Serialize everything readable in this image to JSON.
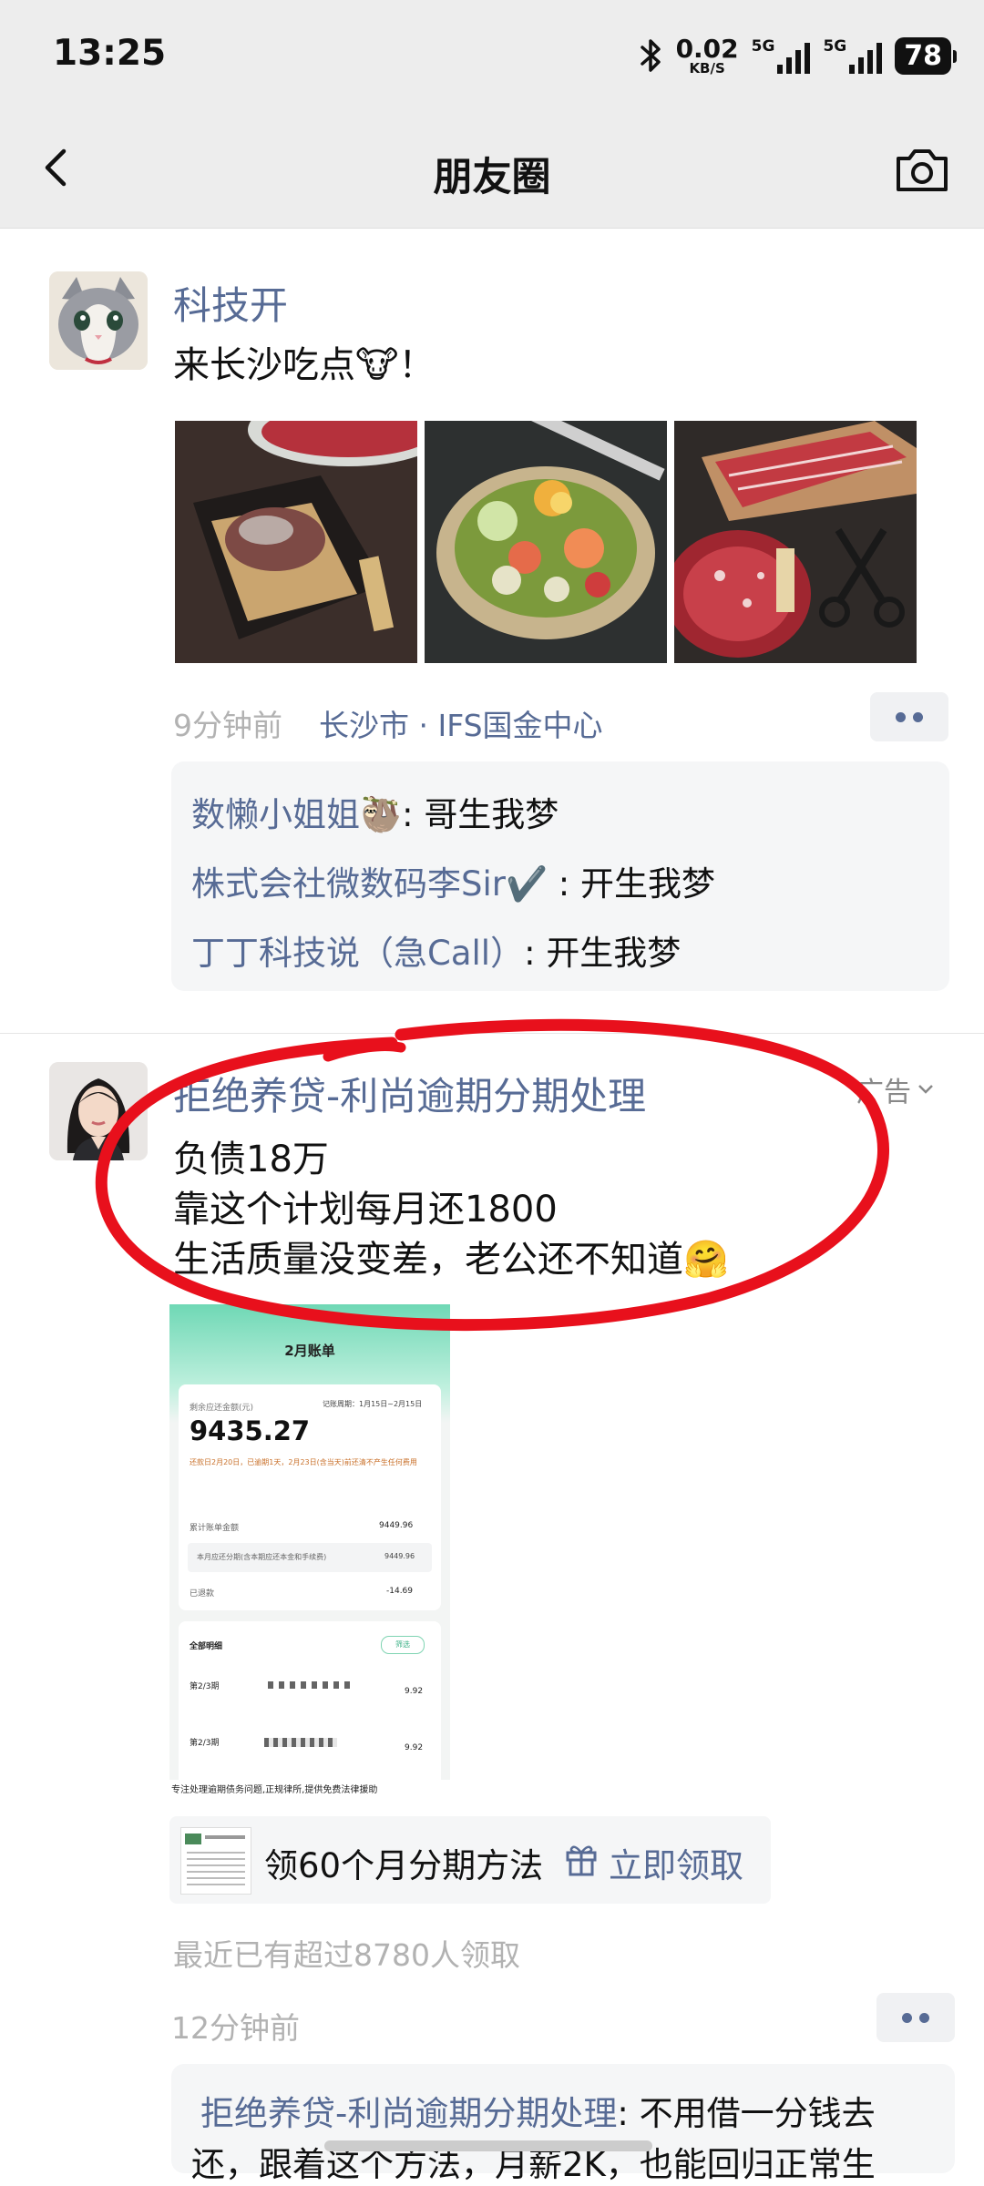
{
  "status_bar": {
    "time": "13:25",
    "net_speed": "0.02",
    "net_unit": "KB/S",
    "signal_1": "5G",
    "signal_2": "5G",
    "battery": "78"
  },
  "nav": {
    "title": "朋友圈"
  },
  "post1": {
    "author": "科技开",
    "text": "来长沙吃点🐮！",
    "time": "9分钟前",
    "location": "长沙市 · IFS国金中心",
    "comments": [
      {
        "name": "数懒小姐姐🦥",
        "sep": ": ",
        "text": "哥生我梦"
      },
      {
        "name": "株式会社微数码李Sir✔️",
        "sep": " : ",
        "text": "开生我梦"
      },
      {
        "name": "丁丁科技说（急Call）",
        "sep": ": ",
        "text": "开生我梦"
      }
    ]
  },
  "post2": {
    "author": "拒绝养贷-利尚逾期分期处理",
    "ad_label": "广告",
    "lines": [
      "负债18万",
      "靠这个计划每月还1800",
      "生活质量没变差，老公还不知道🤗"
    ],
    "bill": {
      "title": "2月账单",
      "remaining_label": "剩余应还金额(元)",
      "cycle": "记账周期：1月15日~2月15日",
      "amount": "9435.27",
      "notice": "还款日2月20日，已逾期1天，2月23日(含当天)前还清不产生任何费用",
      "row1_label": "累计账单金额",
      "row1_value": "9449.96",
      "row2_label": "本月应还分期(含本期应还本金和手续费)",
      "row2_value": "9449.96",
      "row3_label": "已退款",
      "row3_value": "-14.69",
      "detail_label": "全部明细",
      "filter_label": "筛选",
      "item1_label": "第2/3期",
      "item1_value": "9.92",
      "item2_label": "第2/3期",
      "item2_value": "9.92"
    },
    "caption": "专注处理逾期债务问题,正规律所,提供免费法律援助",
    "cta_text": "领60个月分期方法",
    "cta_action": "立即领取",
    "stat": "最近已有超过8780人领取",
    "time": "12分钟前",
    "comment": {
      "name": "拒绝养贷-利尚逾期分期处理",
      "sep": ": ",
      "text": "不用借一分钱去",
      "text2": "还，跟着这个方法，月薪2K，也能回归正常生"
    }
  },
  "colors": {
    "link": "#576b95",
    "bar_bg": "#ededed",
    "annotation_red": "#e8101c"
  }
}
